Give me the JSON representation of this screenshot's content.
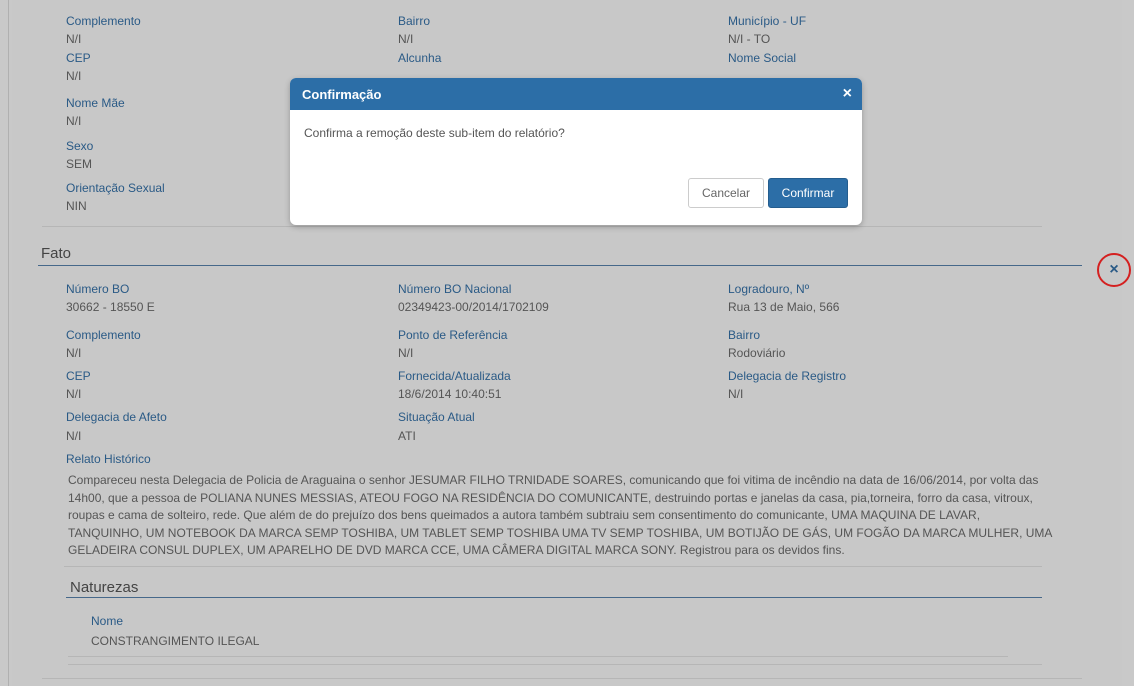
{
  "pessoa": {
    "complemento_label": "Complemento",
    "complemento_value": "N/I",
    "bairro_label": "Bairro",
    "bairro_value": "N/I",
    "municipio_label": "Município - UF",
    "municipio_value": "N/I - TO",
    "cep_label": "CEP",
    "cep_value": "N/I",
    "alcunha_label": "Alcunha",
    "nome_social_label": "Nome Social",
    "nome_mae_label": "Nome Mãe",
    "nome_mae_value": "N/I",
    "sexo_label": "Sexo",
    "sexo_value": "SEM",
    "orientacao_label": "Orientação Sexual",
    "orientacao_value": "NIN"
  },
  "fato": {
    "title": "Fato",
    "numero_bo_label": "Número BO",
    "numero_bo_value": "30662 - 18550 E",
    "numero_bo_nacional_label": "Número BO Nacional",
    "numero_bo_nacional_value": "02349423-00/2014/1702109",
    "logradouro_label": "Logradouro, Nº",
    "logradouro_value": "Rua 13 de Maio, 566",
    "complemento_label": "Complemento",
    "complemento_value": "N/I",
    "ponto_referencia_label": "Ponto de Referência",
    "ponto_referencia_value": "N/I",
    "bairro_label": "Bairro",
    "bairro_value": "Rodoviário",
    "cep_label": "CEP",
    "cep_value": "N/I",
    "fornecida_label": "Fornecida/Atualizada",
    "fornecida_value": "18/6/2014 10:40:51",
    "delegacia_registro_label": "Delegacia de Registro",
    "delegacia_registro_value": "N/I",
    "delegacia_afeto_label": "Delegacia de Afeto",
    "delegacia_afeto_value": "N/I",
    "situacao_label": "Situação Atual",
    "situacao_value": "ATI",
    "relato_label": "Relato Histórico",
    "relato_value": "Compareceu nesta Delegacia de Policia de Araguaina o senhor JESUMAR FILHO TRNIDADE SOARES, comunicando que foi vitima de incêndio na data de 16/06/2014, por volta das 14h00, que a pessoa de POLIANA NUNES MESSIAS, ATEOU FOGO NA RESIDÊNCIA DO COMUNICANTE, destruindo portas e janelas da casa, pia,torneira, forro da casa, vitroux, roupas e cama de solteiro, rede. Que além de do prejuízo dos bens queimados a autora também subtraiu sem consentimento do comunicante, UMA MAQUINA DE LAVAR, TANQUINHO, UM NOTEBOOK DA MARCA SEMP TOSHIBA, UM TABLET SEMP TOSHIBA UMA TV SEMP TOSHIBA, UM BOTIJÃO DE GÁS, UM FOGÃO DA MARCA MULHER, UMA GELADEIRA CONSUL DUPLEX, UM APARELHO DE DVD MARCA CCE, UMA CÂMERA DIGITAL MARCA SONY. Registrou para os devidos fins."
  },
  "naturezas": {
    "title": "Naturezas",
    "nome_label": "Nome",
    "nome_value": "CONSTRANGIMENTO ILEGAL"
  },
  "remove_icon": "×",
  "modal": {
    "title": "Confirmação",
    "close_icon": "×",
    "message": "Confirma a remoção deste sub-item do relatório?",
    "cancel_label": "Cancelar",
    "confirm_label": "Confirmar"
  }
}
